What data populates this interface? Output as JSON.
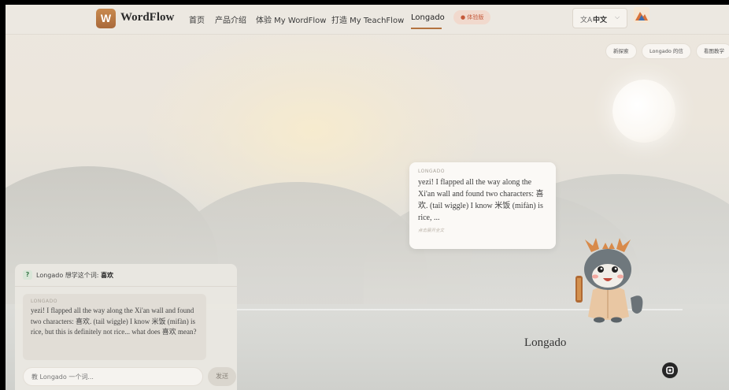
{
  "nav": {
    "logo_letter": "W",
    "brand": "WordFlow",
    "links": [
      "首页",
      "产品介绍",
      "体验 My WordFlow",
      "打造 My TeachFlow",
      "Longado"
    ],
    "active": "Longado",
    "badge": "● 体验版",
    "lang_icon": "文A",
    "lang_label": "中文",
    "lang_chevron": "⌵"
  },
  "chips": [
    "新探索",
    "Longado 的信",
    "看图教学"
  ],
  "bubble": {
    "label": "LONGADO",
    "text": "yezi! I flapped all the way along the Xi'an wall and found two characters: 喜欢. (tail wiggle) I know 米饭 (mifàn) is rice, ...",
    "hint": "点击展开全文"
  },
  "character_name": "Longado",
  "chat": {
    "head_icon": "?",
    "head_prefix": "Longado 想学这个词:",
    "head_word": "喜欢",
    "msg_label": "LONGADO",
    "msg_text": "yezi! I flapped all the way along the Xi'an wall and found two characters: 喜欢. (tail wiggle) I know 米饭 (mifàn) is rice, but this is definitely not rice... what does 喜欢 mean?",
    "input_placeholder": "教 Longado 一个词...",
    "send_label": "发送"
  },
  "colors": {
    "accent": "#b4733f",
    "badge_text": "#c4593a",
    "fab": "#262626"
  }
}
